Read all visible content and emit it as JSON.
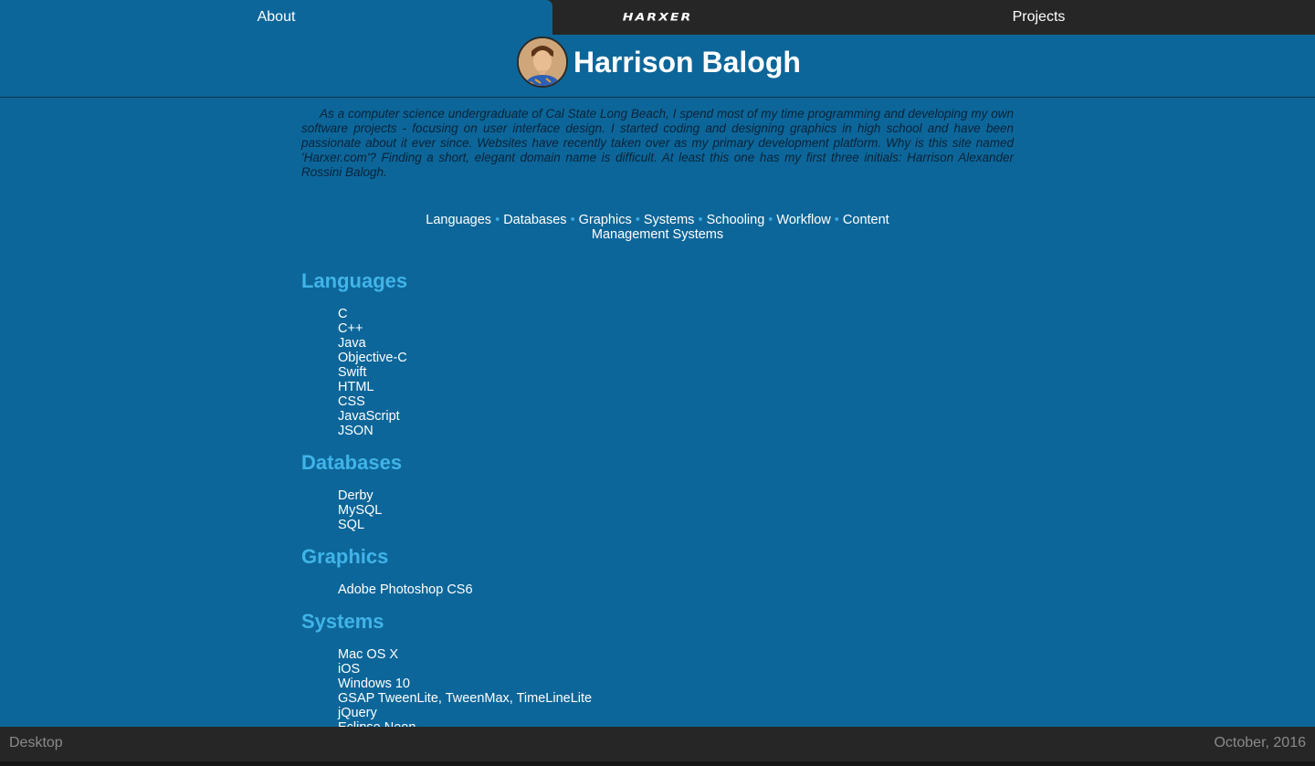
{
  "nav": {
    "about_label": "About",
    "logo_text": "HARXER",
    "projects_label": "Projects"
  },
  "header": {
    "name": "Harrison Balogh"
  },
  "intro": "As a computer science undergraduate of Cal State Long Beach, I spend most of my time programming and developing my own software projects - focusing on user interface design. I started coding and designing graphics in high school and have been passionate about it ever since. Websites have recently taken over as my primary development platform. Why is this site named 'Harxer.com'? Finding a short, elegant domain name is difficult. At least this one has my first three initials: Harrison Alexander Rossini Balogh.",
  "toc": [
    "Languages",
    "Databases",
    "Graphics",
    "Systems",
    "Schooling",
    "Workflow",
    "Content Management Systems"
  ],
  "toc_separator": "•",
  "sections": {
    "languages": {
      "title": "Languages",
      "items": [
        "C",
        "C++",
        "Java",
        "Objective-C",
        "Swift",
        "HTML",
        "CSS",
        "JavaScript",
        "JSON"
      ]
    },
    "databases": {
      "title": "Databases",
      "items": [
        "Derby",
        "MySQL",
        "SQL"
      ]
    },
    "graphics": {
      "title": "Graphics",
      "items": [
        "Adobe Photoshop CS6"
      ]
    },
    "systems": {
      "title": "Systems",
      "items": [
        "Mac OS X",
        "iOS",
        "Windows 10",
        "GSAP TweenLite, TweenMax, TimeLineLite",
        "jQuery",
        "Eclipse Neon"
      ]
    }
  },
  "footer": {
    "left": "Desktop",
    "right": "October, 2016"
  },
  "colors": {
    "page_bg": "#0d6699",
    "nav_bg": "#262626",
    "heading": "#40b4e8",
    "intro_text": "#07243a"
  }
}
